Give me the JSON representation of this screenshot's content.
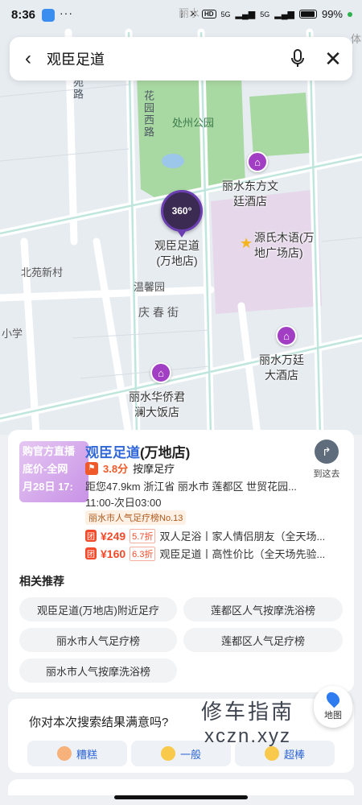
{
  "status_bar": {
    "time": "8:36",
    "dots": "···",
    "hd": "HD",
    "net1": "5G",
    "net2": "5G",
    "battery_pct": "99%"
  },
  "search": {
    "query": "观臣足道"
  },
  "map": {
    "road_labels": [
      "北苑路",
      "花园西路",
      "庆春街"
    ],
    "park_label": "处州公园",
    "area_labels": [
      "北苑新村",
      "温馨园",
      "小学"
    ],
    "pois": [
      {
        "name": "丽水东方文\n廷酒店",
        "icon": "hotel-icon"
      },
      {
        "name": "源氏木语(万\n地广场店)",
        "icon": "star-icon"
      },
      {
        "name": "丽水万廷\n大酒店",
        "icon": "hotel-icon"
      },
      {
        "name": "丽水华侨君\n澜大饭店",
        "icon": "hotel-icon"
      }
    ],
    "selected": {
      "name": "观臣足道\n(万地店)",
      "pano": "360°"
    },
    "edge_top": "丽水",
    "edge_right": "体"
  },
  "result": {
    "thumb_lines": [
      "购官方直播",
      "底价-全网",
      "月28日 17:"
    ],
    "name_highlight": "观臣足道",
    "name_rest": "(万地店)",
    "score": "3.8分",
    "category": "按摩足疗",
    "address": "距您47.9km  浙江省 丽水市 莲都区 世贸花园...",
    "hours": "11:00-次日03:00",
    "rank": "丽水市人气足疗榜No.13",
    "deals": [
      {
        "tag": "团",
        "price": "¥249",
        "discount": "5.7折",
        "desc": "双人足浴丨家人情侣朋友（全天场..."
      },
      {
        "tag": "团",
        "price": "¥160",
        "discount": "6.3折",
        "desc": "观臣足道丨高性价比（全天场先验..."
      }
    ],
    "go_label": "到这去"
  },
  "recommend": {
    "title": "相关推荐",
    "chips": [
      "观臣足道(万地店)附近足疗",
      "莲都区人气按摩洗浴榜",
      "丽水市人气足疗榜",
      "莲都区人气足疗榜",
      "丽水市人气按摩洗浴榜"
    ]
  },
  "survey": {
    "question": "你对本次搜索结果满意吗?",
    "options": [
      "糟糕",
      "一般",
      "超棒"
    ]
  },
  "watermark": {
    "cn": "修车指南",
    "en": "xczn.xyz"
  },
  "fab": {
    "label": "地图"
  }
}
